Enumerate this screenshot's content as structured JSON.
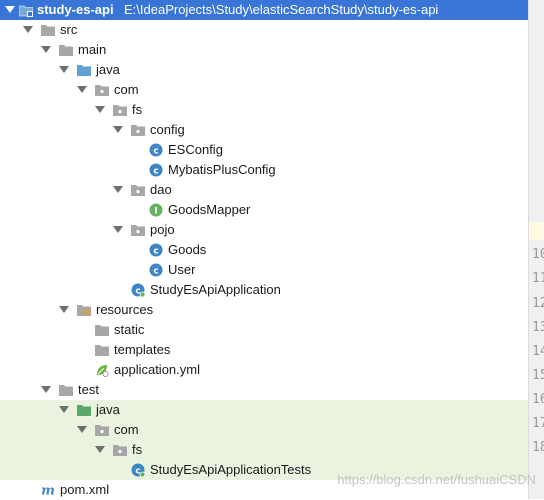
{
  "project": {
    "name": "study-es-api",
    "path": "E:\\IdeaProjects\\Study\\elasticSearchStudy\\study-es-api"
  },
  "tree": {
    "src": "src",
    "main": "main",
    "java": "java",
    "com": "com",
    "fs": "fs",
    "config": "config",
    "esconfig": "ESConfig",
    "mybatis": "MybatisPlusConfig",
    "dao": "dao",
    "goodsmapper": "GoodsMapper",
    "pojo": "pojo",
    "goods": "Goods",
    "user": "User",
    "app": "StudyEsApiApplication",
    "resources": "resources",
    "static": "static",
    "templates": "templates",
    "appyml": "application.yml",
    "test": "test",
    "test_java": "java",
    "test_com": "com",
    "test_fs": "fs",
    "tests": "StudyEsApiApplicationTests",
    "pom": "pom.xml"
  },
  "gutter_lines": [
    "10",
    "11",
    "12",
    "13",
    "14",
    "15",
    "16",
    "17",
    "18"
  ],
  "watermark": "https://blog.csdn.net/fushuaiCSDN",
  "colors": {
    "selection": "#3875d7",
    "test_background": "#eaf3e0",
    "folder": "#a7a7a7",
    "source_folder": "#5ea1d6",
    "test_folder": "#59a869",
    "class_icon": "#3e86c7",
    "interface_icon": "#64b15f"
  }
}
